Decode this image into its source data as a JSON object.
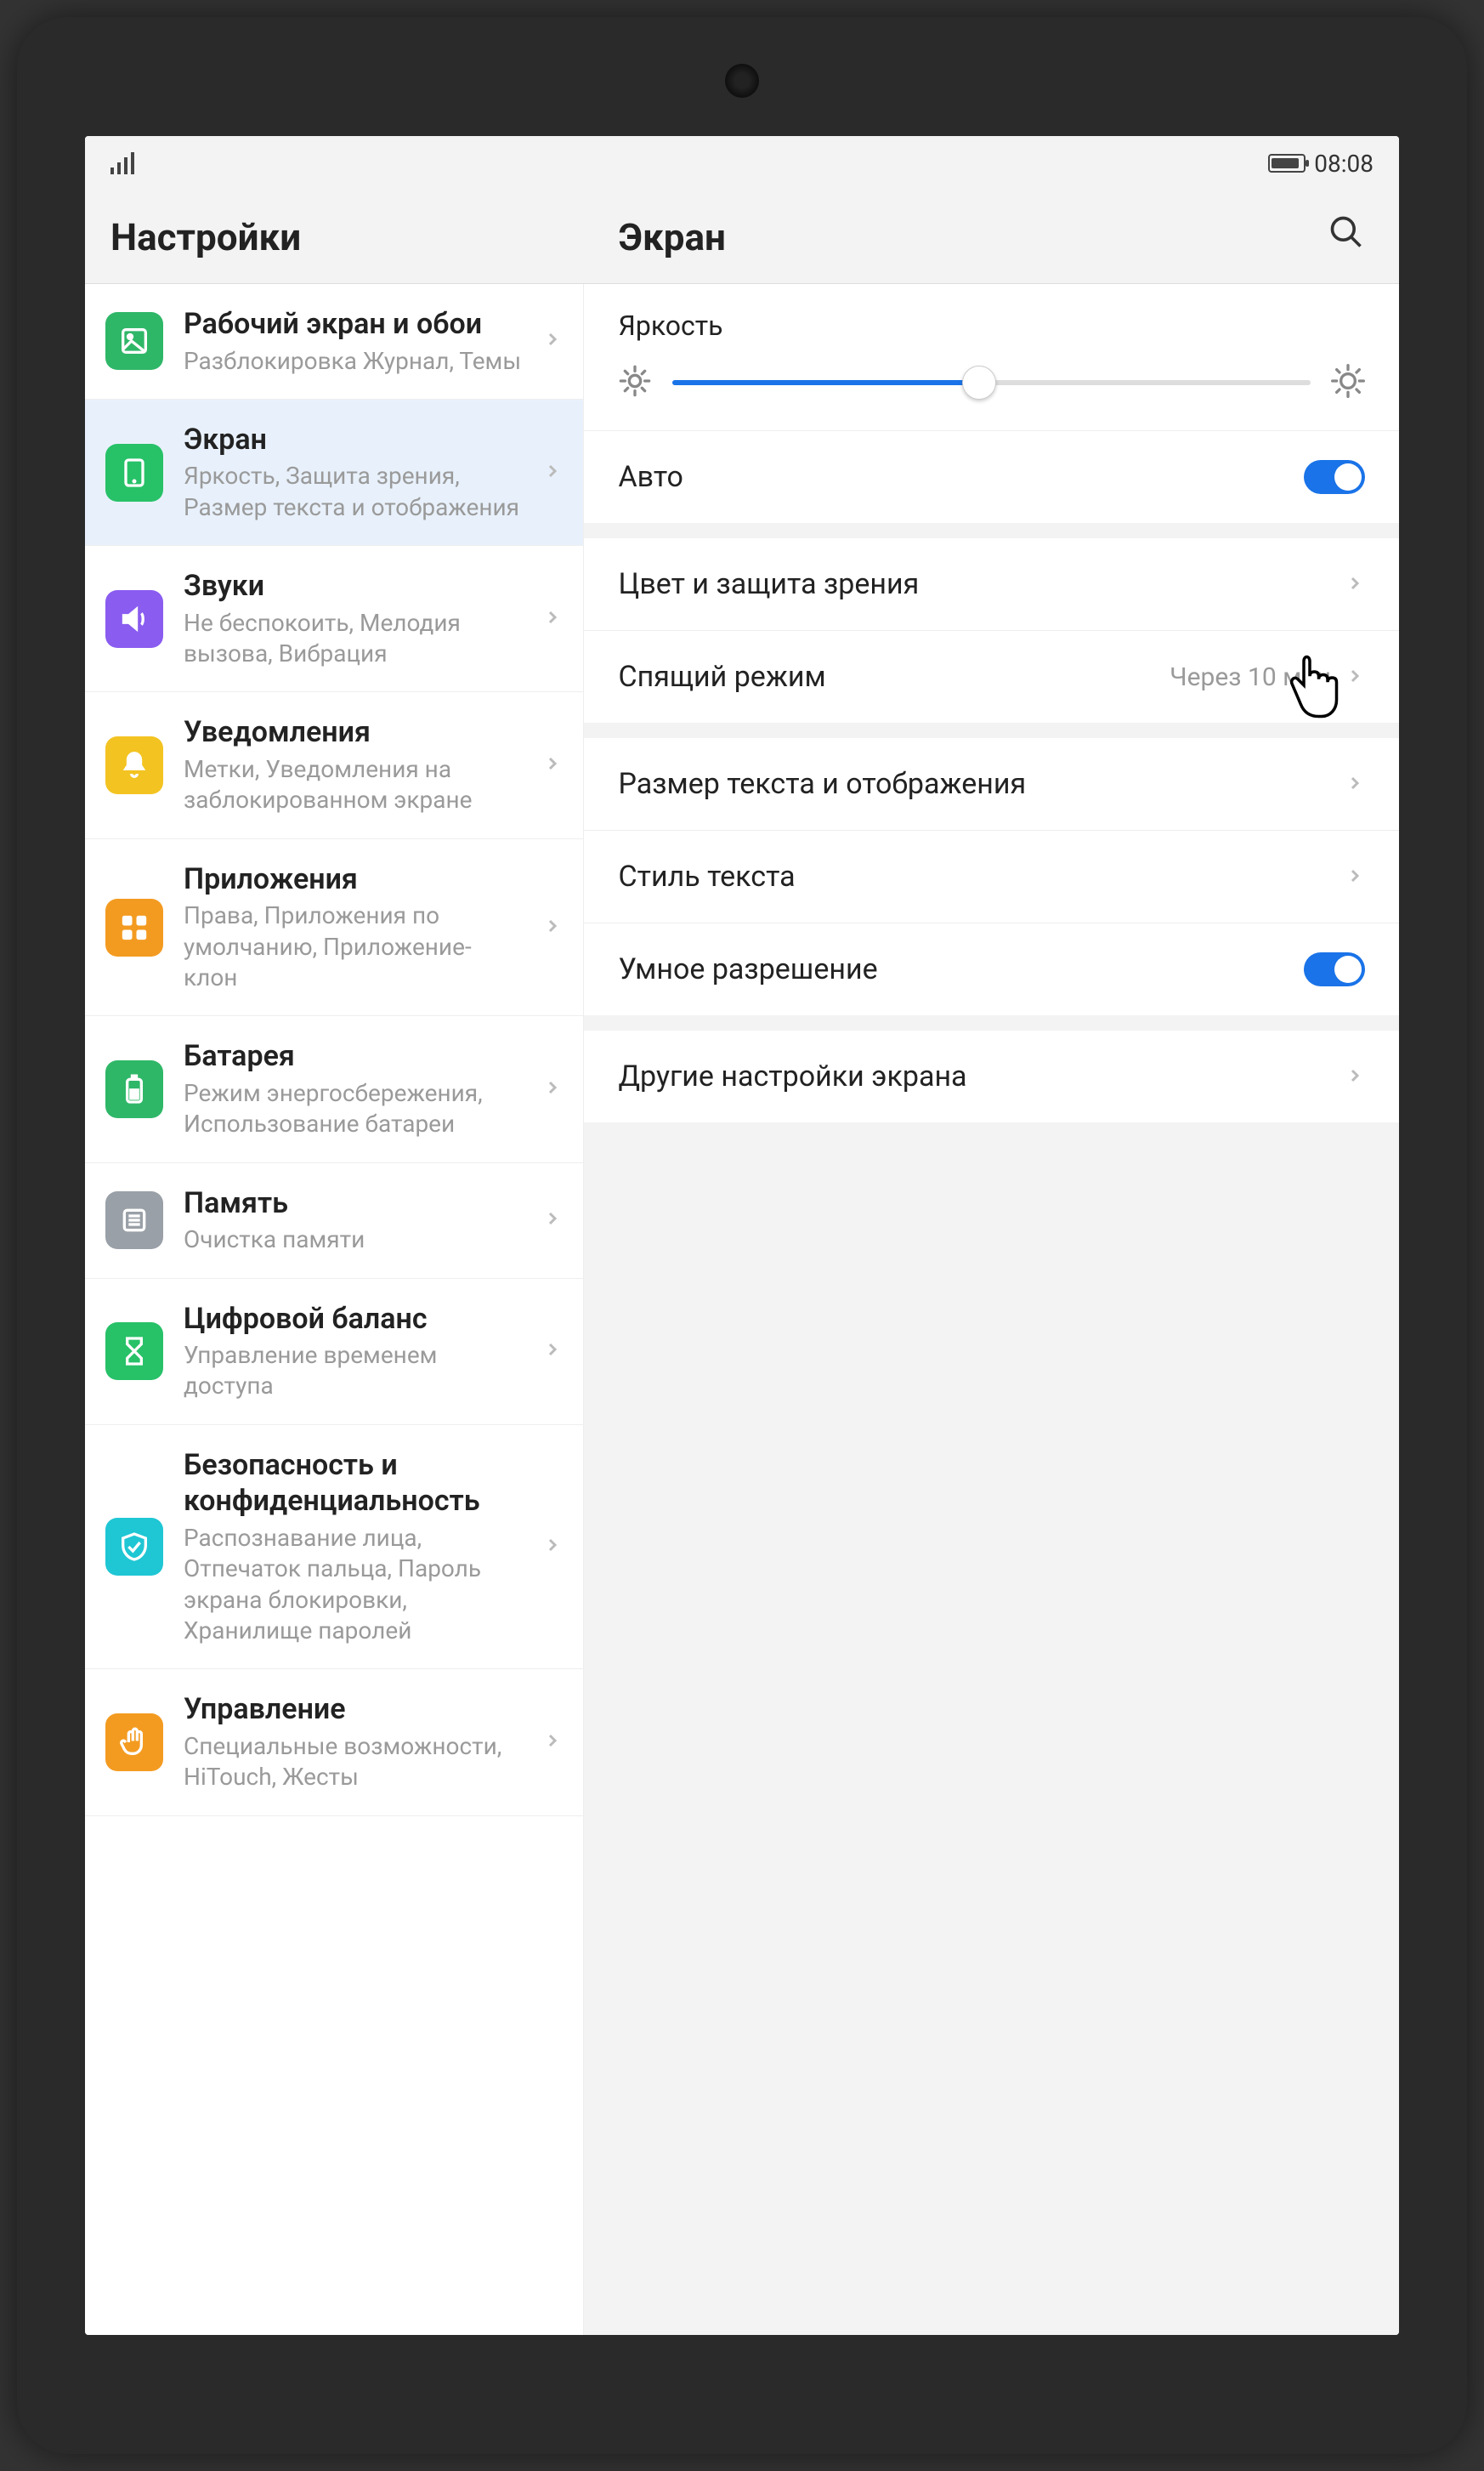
{
  "status": {
    "time": "08:08"
  },
  "header": {
    "settings_title": "Настройки",
    "detail_title": "Экран"
  },
  "sidebar": {
    "items": [
      {
        "title": "Рабочий экран и обои",
        "sub": "Разблокировка Журнал, Темы",
        "icon": "wallpaper",
        "color": "bg-green",
        "active": false
      },
      {
        "title": "Экран",
        "sub": "Яркость, Защита зрения, Размер текста и отображения",
        "icon": "display",
        "color": "bg-green2",
        "active": true
      },
      {
        "title": "Звуки",
        "sub": "Не беспокоить, Мелодия вызова, Вибрация",
        "icon": "sound",
        "color": "bg-purple",
        "active": false
      },
      {
        "title": "Уведомления",
        "sub": "Метки, Уведомления на заблокированном экране",
        "icon": "bell",
        "color": "bg-yellow",
        "active": false
      },
      {
        "title": "Приложения",
        "sub": "Права, Приложения по умолчанию, Приложение-клон",
        "icon": "apps",
        "color": "bg-orange",
        "active": false
      },
      {
        "title": "Батарея",
        "sub": "Режим энергосбере­жения, Использование батареи",
        "icon": "battery",
        "color": "bg-green",
        "active": false
      },
      {
        "title": "Память",
        "sub": "Очистка памяти",
        "icon": "memory",
        "color": "bg-grey",
        "active": false
      },
      {
        "title": "Цифровой баланс",
        "sub": "Управление временем доступа",
        "icon": "hourglass",
        "color": "bg-green2",
        "active": false
      },
      {
        "title": "Безопасность и конфиденциаль­ность",
        "sub": "Распознавание лица, Отпечаток пальца, Пароль экрана бло­кировки, Хранилище паролей",
        "icon": "shield",
        "color": "bg-teal",
        "active": false
      },
      {
        "title": "Управление",
        "sub": "Специальные возможности, HiTouch, Жесты",
        "icon": "hand",
        "color": "bg-orange",
        "active": false
      }
    ]
  },
  "detail": {
    "brightness_label": "Яркость",
    "brightness_percent": 48,
    "auto_label": "Авто",
    "auto_on": true,
    "groups": [
      [
        {
          "label": "Цвет и защита зрения",
          "value": "",
          "type": "nav"
        },
        {
          "label": "Спящий режим",
          "value": "Через 10 мин",
          "type": "nav",
          "cursor": true
        }
      ],
      [
        {
          "label": "Размер текста и отображения",
          "value": "",
          "type": "nav"
        },
        {
          "label": "Стиль текста",
          "value": "",
          "type": "nav"
        },
        {
          "label": "Умное разрешение",
          "value": "",
          "type": "toggle",
          "on": true
        }
      ],
      [
        {
          "label": "Другие настройки экрана",
          "value": "",
          "type": "nav"
        }
      ]
    ]
  }
}
